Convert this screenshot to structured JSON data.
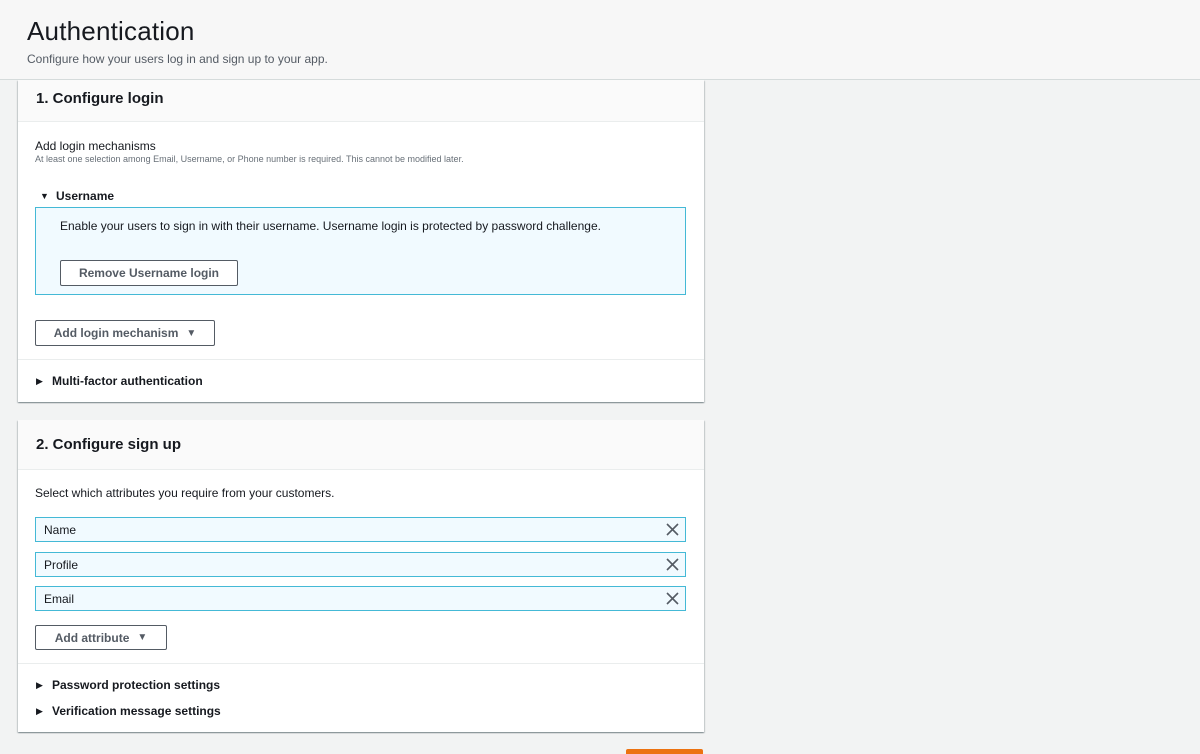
{
  "header": {
    "title": "Authentication",
    "subtitle": "Configure how your users log in and sign up to your app."
  },
  "login": {
    "title": "1. Configure login",
    "mechanisms_label": "Add login mechanisms",
    "mechanisms_hint": "At least one selection among Email, Username, or Phone number is required. This cannot be modified later.",
    "username_section": "Username",
    "username_description": "Enable your users to sign in with their username. Username login is protected by password challenge.",
    "remove_button": "Remove Username login",
    "add_mechanism_button": "Add login mechanism",
    "mfa_section": "Multi-factor authentication"
  },
  "signup": {
    "title": "2. Configure sign up",
    "instruction": "Select which attributes you require from your customers.",
    "attributes": [
      "Name",
      "Profile",
      "Email"
    ],
    "add_attribute_button": "Add attribute",
    "password_section": "Password protection settings",
    "verification_section": "Verification message settings"
  },
  "icons": {
    "expanded_caret": "caret-down-icon",
    "collapsed_caret": "caret-right-icon",
    "dropdown": "caret-down-icon",
    "remove_token": "close-icon"
  },
  "colors": {
    "accent_border": "#44b9d6",
    "info_background": "#f1faff",
    "primary_orange": "#ec7211"
  }
}
